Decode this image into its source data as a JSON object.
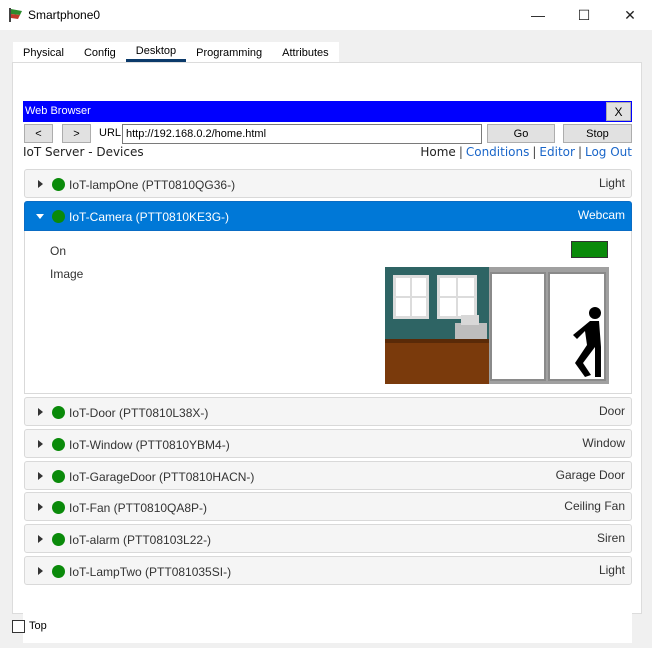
{
  "window": {
    "title": "Smartphone0",
    "minimize_glyph": "—",
    "maximize_glyph": "☐",
    "close_glyph": "✕"
  },
  "tabs": [
    {
      "label": "Physical",
      "active": false
    },
    {
      "label": "Config",
      "active": false
    },
    {
      "label": "Desktop",
      "active": true
    },
    {
      "label": "Programming",
      "active": false
    },
    {
      "label": "Attributes",
      "active": false
    }
  ],
  "browser": {
    "title": "Web Browser",
    "close_label": "X",
    "back_label": "<",
    "forward_label": ">",
    "url_label": "URL",
    "url_value": "http://192.168.0.2/home.html",
    "go_label": "Go",
    "stop_label": "Stop"
  },
  "page": {
    "title": "IoT Server - Devices",
    "nav": {
      "home": "Home",
      "conditions": "Conditions",
      "editor": "Editor",
      "logout": "Log Out",
      "separator": "|"
    }
  },
  "devices": [
    {
      "name": "IoT-lampOne (PTT0810QG36-)",
      "type": "Light",
      "status": "on"
    },
    {
      "name": "IoT-Camera (PTT0810KE3G-)",
      "type": "Webcam",
      "status": "on",
      "expanded": true
    },
    {
      "name": "IoT-Door (PTT0810L38X-)",
      "type": "Door",
      "status": "on"
    },
    {
      "name": "IoT-Window (PTT0810YBM4-)",
      "type": "Window",
      "status": "on"
    },
    {
      "name": "IoT-GarageDoor (PTT0810HACN-)",
      "type": "Garage Door",
      "status": "on"
    },
    {
      "name": "IoT-Fan (PTT0810QA8P-)",
      "type": "Ceiling Fan",
      "status": "on"
    },
    {
      "name": "IoT-alarm (PTT08103L22-)",
      "type": "Siren",
      "status": "on"
    },
    {
      "name": "IoT-LampTwo (PTT081035SI-)",
      "type": "Light",
      "status": "on"
    }
  ],
  "camera_detail": {
    "on_label": "On",
    "image_label": "Image",
    "on_state": true
  },
  "footer": {
    "top_label": "Top",
    "top_checked": false
  },
  "colors": {
    "browser_bar": "#0000ff",
    "expanded_row": "#0078d7",
    "status_green": "#0a8a0a",
    "link_blue": "#1a66c9"
  }
}
